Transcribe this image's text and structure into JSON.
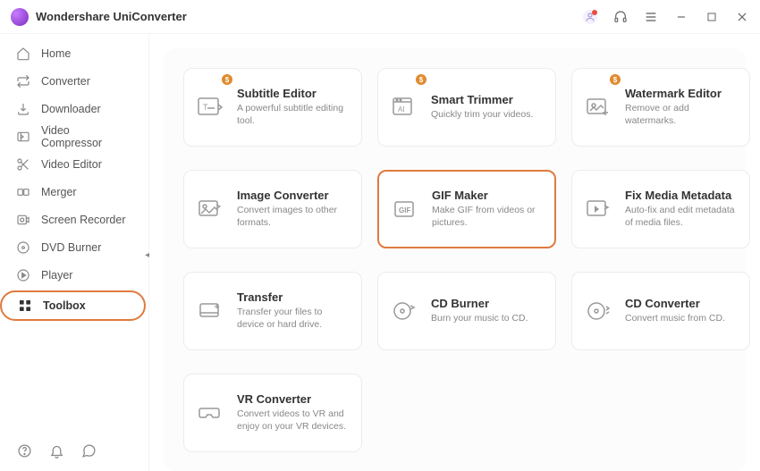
{
  "app": {
    "title": "Wondershare UniConverter"
  },
  "sidebar": {
    "items": [
      {
        "label": "Home"
      },
      {
        "label": "Converter"
      },
      {
        "label": "Downloader"
      },
      {
        "label": "Video Compressor"
      },
      {
        "label": "Video Editor"
      },
      {
        "label": "Merger"
      },
      {
        "label": "Screen Recorder"
      },
      {
        "label": "DVD Burner"
      },
      {
        "label": "Player"
      },
      {
        "label": "Toolbox"
      }
    ],
    "active_index": 9
  },
  "tools": [
    {
      "title": "Subtitle Editor",
      "desc": "A powerful subtitle editing tool.",
      "badge": "$"
    },
    {
      "title": "Smart Trimmer",
      "desc": "Quickly trim your videos.",
      "badge": "$"
    },
    {
      "title": "Watermark Editor",
      "desc": "Remove or add watermarks.",
      "badge": "$"
    },
    {
      "title": "Image Converter",
      "desc": "Convert images to other formats."
    },
    {
      "title": "GIF Maker",
      "desc": "Make GIF from videos or pictures.",
      "highlight": true
    },
    {
      "title": "Fix Media Metadata",
      "desc": "Auto-fix and edit metadata of media files."
    },
    {
      "title": "Transfer",
      "desc": "Transfer your files to device or hard drive."
    },
    {
      "title": "CD Burner",
      "desc": "Burn your music to CD."
    },
    {
      "title": "CD Converter",
      "desc": "Convert music from CD."
    },
    {
      "title": "VR Converter",
      "desc": "Convert videos to VR and enjoy on your VR devices."
    }
  ]
}
